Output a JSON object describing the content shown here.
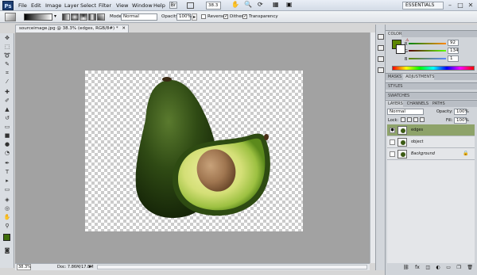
{
  "app": {
    "logo": "Ps",
    "zoom_menu_value": "38.3",
    "workspace": "ESSENTIALS"
  },
  "menu": [
    "File",
    "Edit",
    "Image",
    "Layer",
    "Select",
    "Filter",
    "View",
    "Window",
    "Help"
  ],
  "window_controls": {
    "minimize": "–",
    "restore": "□",
    "close": "✕"
  },
  "options": {
    "mode_label": "Mode:",
    "mode_value": "Normal",
    "opacity_label": "Opacity:",
    "opacity_value": "100%",
    "reverse_label": "Reverse",
    "reverse_checked": false,
    "dither_label": "Dither",
    "dither_checked": true,
    "transparency_label": "Transparency",
    "transparency_checked": true
  },
  "document": {
    "tab_title": "sourceimage.jpg @ 38.3% (edges, RGB/8#) *",
    "zoom": "38.3%",
    "doc_info": "Doc: 7.86M/17.8M"
  },
  "panels": {
    "color": {
      "tab": "COLOR",
      "r": "92",
      "g": "134",
      "b": "1",
      "fg_color": "#5c8601"
    },
    "masks_tab": "MASKS",
    "adjustments_tab": "ADJUSTMENTS",
    "styles_tab": "STYLES",
    "swatches_tab": "SWATCHES",
    "layers": {
      "tabs": [
        "LAYERS",
        "CHANNELS",
        "PATHS"
      ],
      "blend_mode": "Normal",
      "opacity_label": "Opacity:",
      "opacity": "100%",
      "lock_label": "Lock:",
      "fill_label": "Fill:",
      "fill": "100%",
      "items": [
        {
          "name": "edges",
          "selected": true,
          "visible": true
        },
        {
          "name": "object",
          "selected": false,
          "visible": false
        },
        {
          "name": "Background",
          "selected": false,
          "visible": false,
          "locked": true
        }
      ]
    }
  }
}
